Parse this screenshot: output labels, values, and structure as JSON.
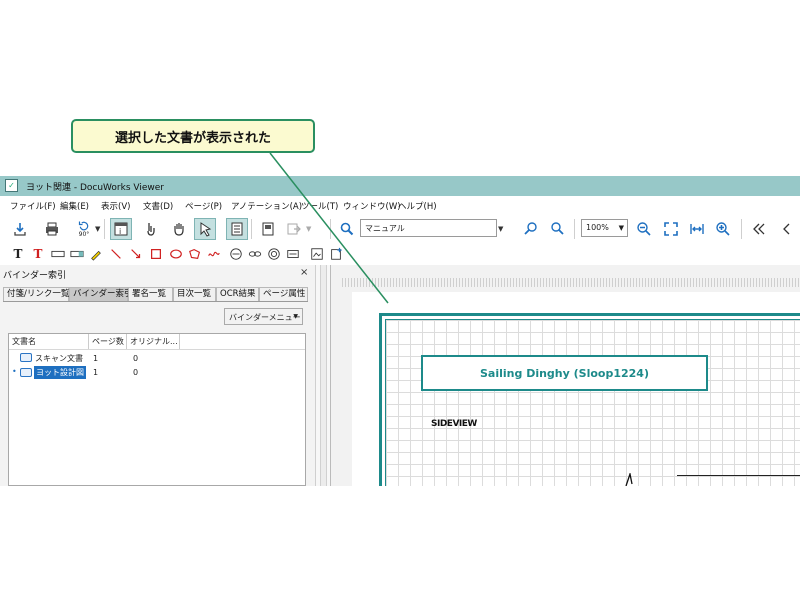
{
  "callout": {
    "text": "選択した文書が表示された"
  },
  "window": {
    "title": "ヨット関連 - DocuWorks Viewer"
  },
  "menu": [
    "ファイル(F)",
    "編集(E)",
    "表示(V)",
    "文書(D)",
    "ページ(P)",
    "アノテーション(A)",
    "ツール(T)",
    "ウィンドウ(W)",
    "ヘルプ(H)"
  ],
  "toolbar": {
    "rotate_label": "90°",
    "search_placeholder": "マニュアル",
    "zoom_value": "100%",
    "dropdown_glyph": "▼"
  },
  "annotation_glyphs": {
    "text_black": "T",
    "text_red": "T"
  },
  "panel": {
    "title": "バインダー索引",
    "close": "×",
    "tabs": [
      "付箋/リンク一覧",
      "バインダー索引",
      "署名一覧",
      "目次一覧",
      "OCR結果",
      "ページ属性"
    ],
    "active_tab": 1,
    "binder_menu_label": "バインダーメニュー",
    "columns": [
      "文書名",
      "ページ数",
      "オリジナル..."
    ],
    "rows": [
      {
        "name": "スキャン文書",
        "pages": "1",
        "original": "0"
      },
      {
        "name": "ヨット設計図",
        "pages": "1",
        "original": "0"
      }
    ]
  },
  "document": {
    "title": "Sailing Dinghy (Sloop1224)",
    "side_view": "SIDEVIEW",
    "accent_color": "#1d8a8a"
  }
}
